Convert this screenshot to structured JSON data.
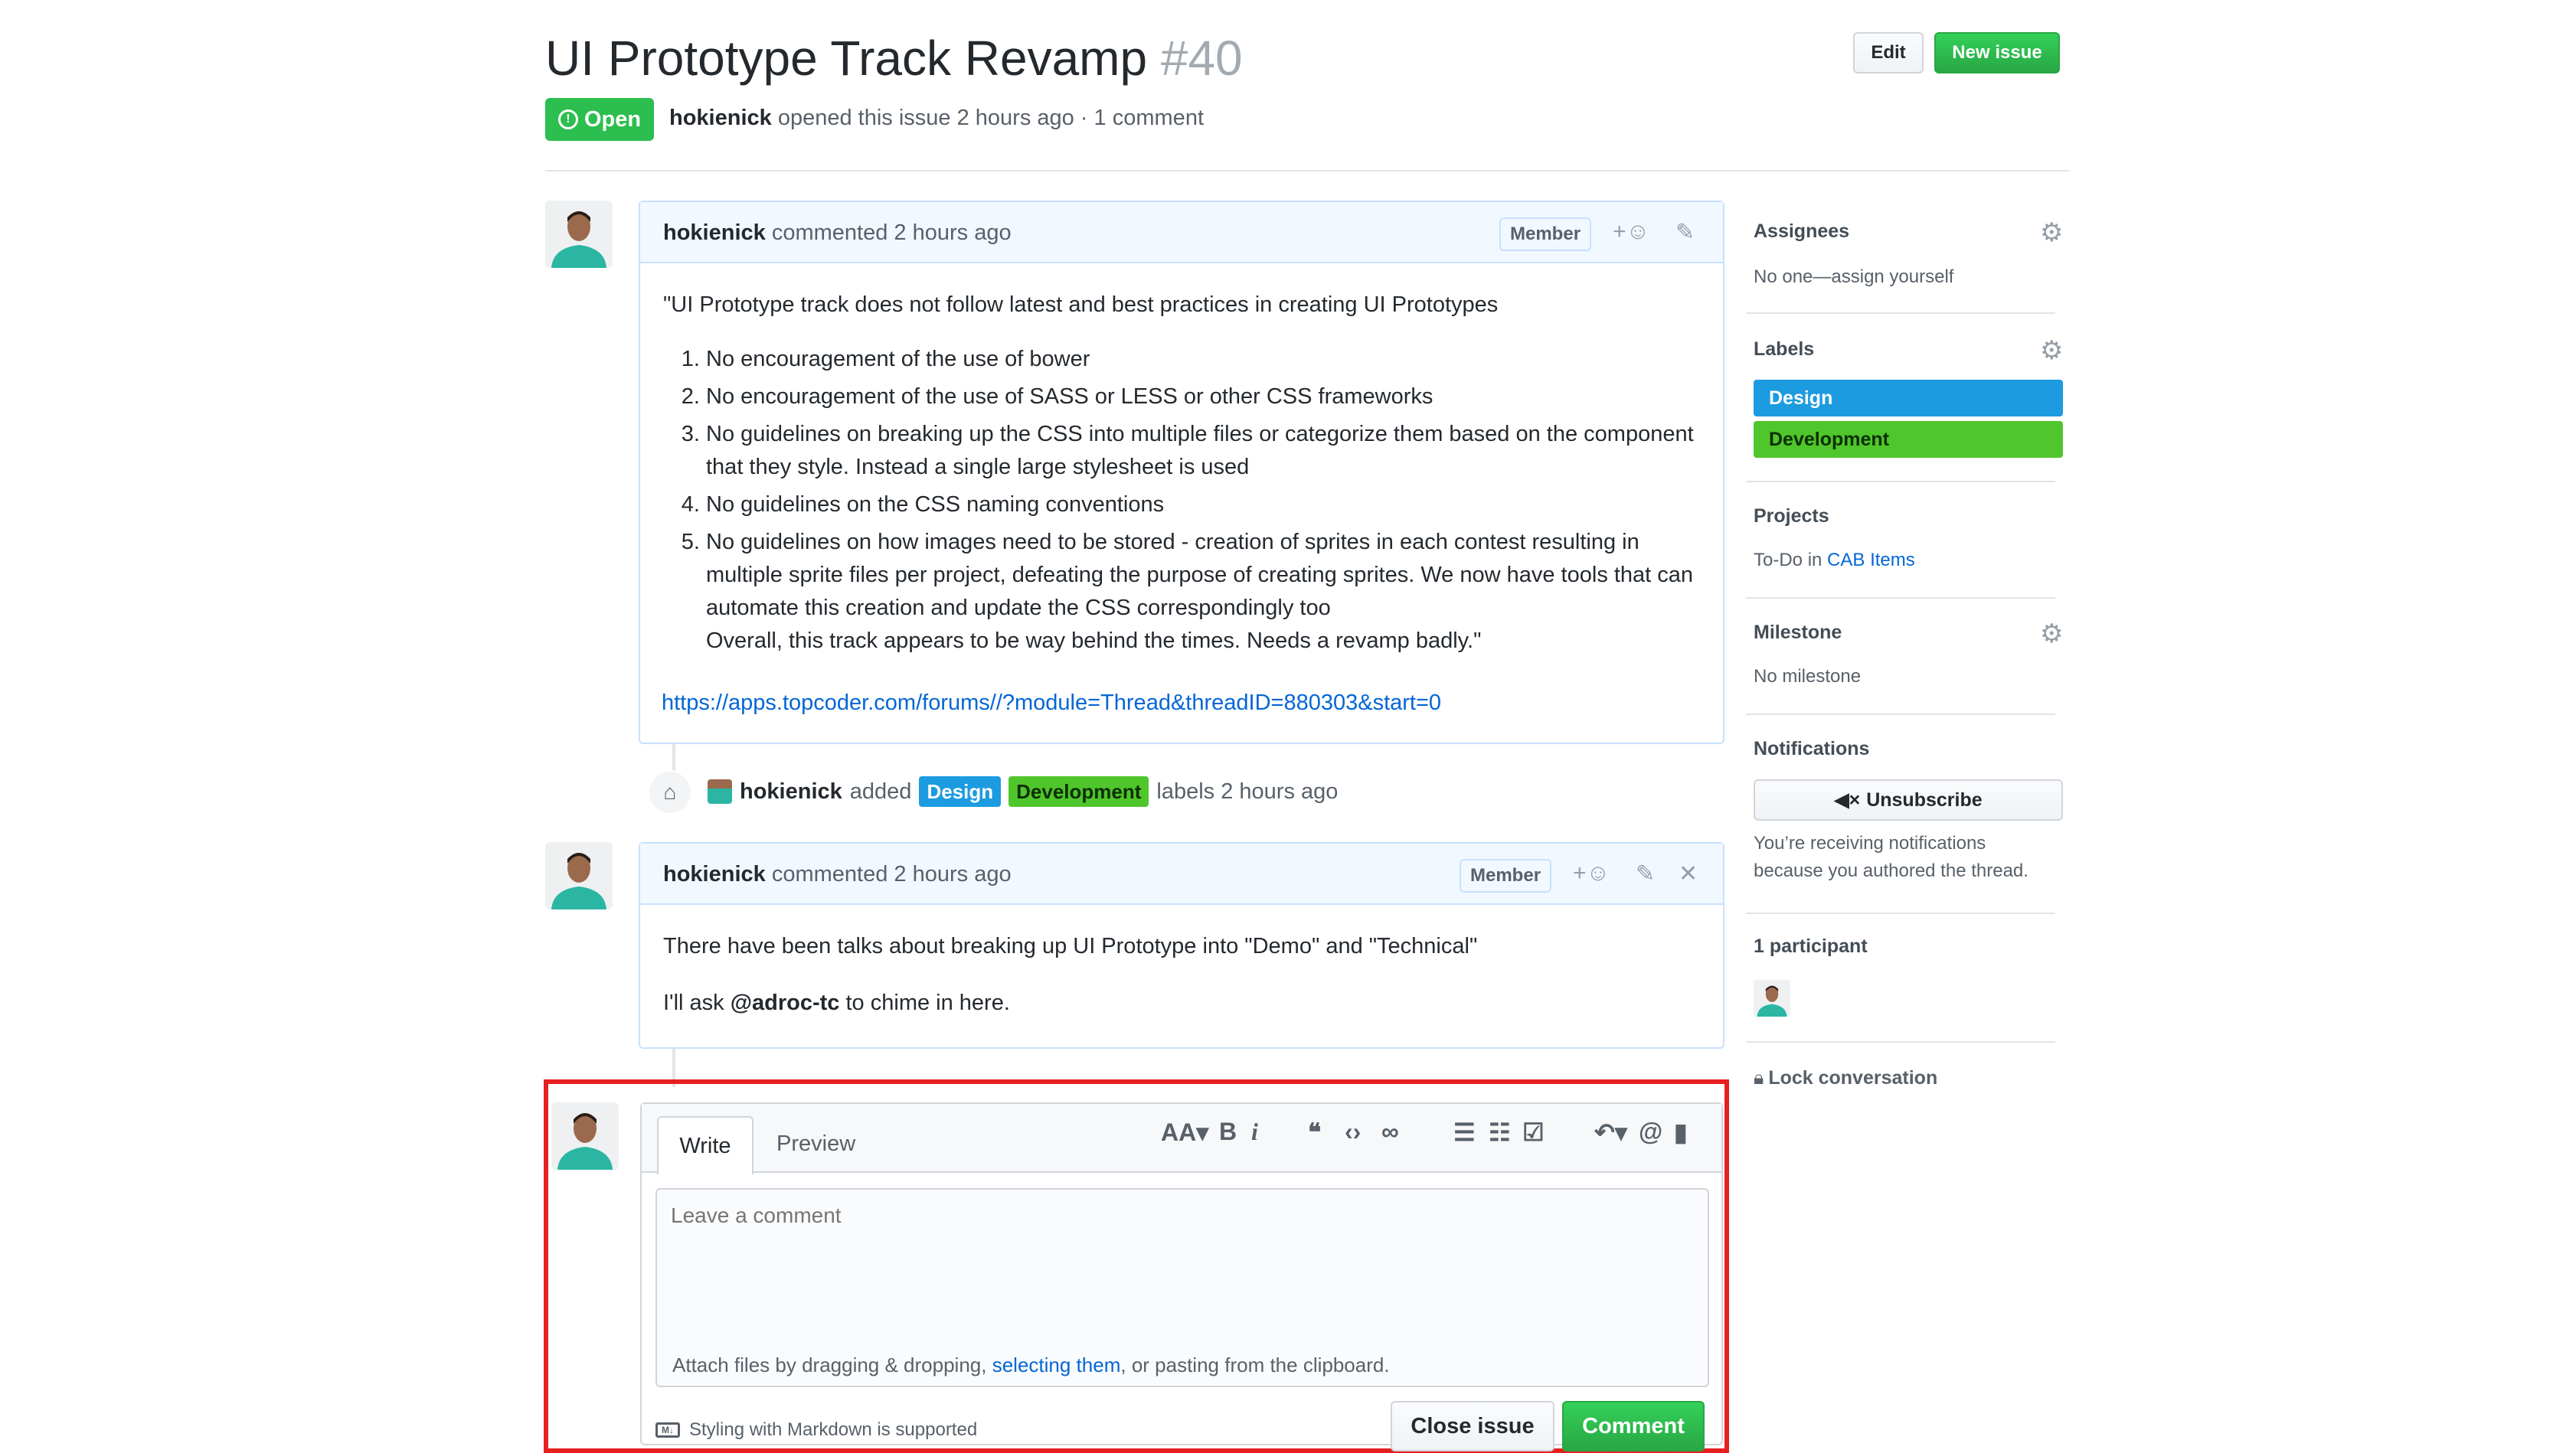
{
  "header": {
    "title": "UI Prototype Track Revamp",
    "number": "#40",
    "edit_label": "Edit",
    "new_issue_label": "New issue",
    "state": "Open",
    "author": "hokienick",
    "meta": "opened this issue 2 hours ago · 1 comment"
  },
  "comments": [
    {
      "author": "hokienick",
      "meta": "commented 2 hours ago",
      "badge": "Member",
      "intro": "\"UI Prototype track does not follow latest and best practices in creating UI Prototypes",
      "items": [
        "No encouragement of the use of bower",
        "No encouragement of the use of SASS or LESS or other CSS frameworks",
        "No guidelines on breaking up the CSS into multiple files or categorize them based on the component that they style. Instead a single large stylesheet is used",
        "No guidelines on the CSS naming conventions",
        "No guidelines on how images need to be stored - creation of sprites in each contest resulting in multiple sprite files per project, defeating the purpose of creating sprites. We now have tools that can automate this creation and update the CSS correspondingly too"
      ],
      "outro": "Overall, this track appears to be way behind the times. Needs a revamp badly.\"",
      "link": "https://apps.topcoder.com/forums//?module=Thread&threadID=880303&start=0"
    },
    {
      "author": "hokienick",
      "meta": "commented 2 hours ago",
      "badge": "Member",
      "line1": "There have been talks about breaking up UI Prototype into \"Demo\" and \"Technical\"",
      "line2_pre": "I'll ask",
      "mention": "@adroc-tc",
      "line2_post": "to chime in here."
    }
  ],
  "event": {
    "author": "hokienick",
    "action": "added",
    "labels": [
      {
        "name": "Design",
        "color": "#1d9be0"
      },
      {
        "name": "Development",
        "color": "#4fc62b"
      }
    ],
    "suffix": "labels 2 hours ago"
  },
  "composer": {
    "tab_write": "Write",
    "tab_preview": "Preview",
    "placeholder": "Leave a comment",
    "attach_pre": "Attach files by dragging & dropping,",
    "attach_link": "selecting them",
    "attach_post": ", or pasting from the clipboard.",
    "markdown_note": "Styling with Markdown is supported",
    "close_label": "Close issue",
    "comment_label": "Comment",
    "highlight_color": "#e62020"
  },
  "sidebar": {
    "assignees_title": "Assignees",
    "assignees_value": "No one—assign yourself",
    "labels_title": "Labels",
    "labels": [
      {
        "name": "Design",
        "color": "#1d9be0"
      },
      {
        "name": "Development",
        "color": "#4fc62b"
      }
    ],
    "projects_title": "Projects",
    "projects_prefix": "To-Do in",
    "projects_link": "CAB Items",
    "milestone_title": "Milestone",
    "milestone_value": "No milestone",
    "notifications_title": "Notifications",
    "unsubscribe_label": "Unsubscribe",
    "notifications_note_1": "You’re receiving notifications",
    "notifications_note_2": "because you authored the thread.",
    "participants_title": "1 participant",
    "lock_label": "Lock conversation"
  }
}
